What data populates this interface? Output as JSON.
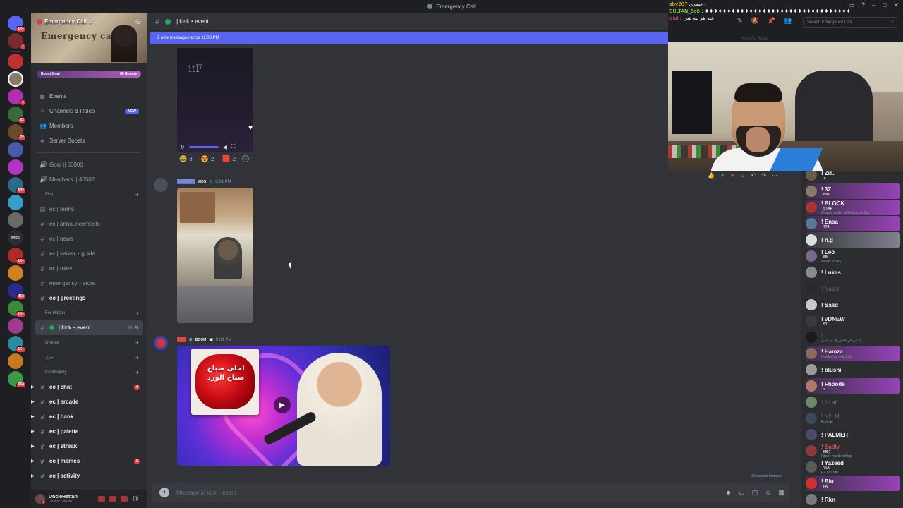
{
  "window": {
    "title": "Emergency Call"
  },
  "server": {
    "name": "Emergency Call",
    "banner_text": "Emergency call",
    "boost_goal_label": "Boost Goal",
    "boost_count": "66 Boosts"
  },
  "rail": {
    "badges": [
      "1K+",
      "1",
      "1",
      "22",
      "22",
      "502",
      "1K+",
      "416",
      "1K+",
      "1K+",
      "654"
    ],
    "text_server": "Mts"
  },
  "menu": [
    {
      "icon": "calendar-icon",
      "label": "Events"
    },
    {
      "icon": "channels-icon",
      "label": "Channels & Roles",
      "badge": "NEW"
    },
    {
      "icon": "members-icon",
      "label": "Members"
    },
    {
      "icon": "boost-icon",
      "label": "Server Boosts"
    }
  ],
  "stats": [
    {
      "label": "Goal || 50000"
    },
    {
      "label": "Members || 45502"
    }
  ],
  "categories": {
    "first": "First",
    "for_hattan": "For Hattan",
    "groups": "Groups",
    "arabic": "أخرى",
    "community": "Community"
  },
  "channels_first": [
    "ec | terms",
    "ec | announcements",
    "ec | news",
    "ec | server・guide",
    "ec | roles",
    "emergency・store"
  ],
  "channel_greetings": "ec | greetings",
  "channel_selected": "| kick・event",
  "channels_community": [
    {
      "label": "ec | chat",
      "badge": "4"
    },
    {
      "label": "ec | arcade"
    },
    {
      "label": "ec | bank"
    },
    {
      "label": "ec | palette"
    },
    {
      "label": "ec | streak"
    },
    {
      "label": "ec | memes",
      "badge": "1"
    },
    {
      "label": "ec | activity"
    }
  ],
  "user": {
    "name": "UncleHattan",
    "status": "Do Not Disturb"
  },
  "chat": {
    "header": "| kick・event",
    "new_messages": "2 new messages since 11:03 PM",
    "video_mark": "itF",
    "reactions": [
      {
        "emoji": "😂",
        "count": "3"
      },
      {
        "emoji": "😍",
        "count": "2"
      },
      {
        "emoji": "🟥",
        "count": "2"
      }
    ],
    "msg1": {
      "tag": "WDS",
      "time": "8:01 PM"
    },
    "msg2": {
      "tag": "BOOM",
      "time": "8:01 PM"
    },
    "card_text": "احلى صباح صباح الورد",
    "slowmode": "Slowmode Immune",
    "composer_placeholder": "Message #| kick・event"
  },
  "overlay": {
    "chat_lines": [
      {
        "name": "sbv207",
        "text": "خصري :"
      },
      {
        "name": "SULTAN_5o6",
        "text": ": ♦♦♦♦♦♦♦♦♦♦♦♦♦♦♦♦♦♦♦♦♦♦♦♦♦♦♦♦♦♦♦♦♦"
      },
      {
        "name": "aiul",
        "text": ": عيه هو ليه شي"
      }
    ],
    "search_placeholder": "Search Emergency Call",
    "mark_as_read": "Mark As Read"
  },
  "members": [
    {
      "name": "! Zia.",
      "sub": "",
      "tag": "✦",
      "style": "normal"
    },
    {
      "name": "! 3Z",
      "sub": "",
      "tag": "NxT",
      "style": "fancy"
    },
    {
      "name": "! BLOCK",
      "sub": "Always smile, still happy in the",
      "tag": "STAR",
      "style": "fancy"
    },
    {
      "name": "! Ensa",
      "sub": "",
      "tag": "774",
      "style": "fancy"
    },
    {
      "name": "! h.g",
      "sub": "",
      "tag": "",
      "style": "fancy2"
    },
    {
      "name": "! Leo",
      "sub": "ARAB PURE",
      "tag": "MK",
      "style": "normal"
    },
    {
      "name": "! Lukas",
      "sub": "",
      "tag": "",
      "style": "normal"
    },
    {
      "name": "! Nasol",
      "sub": "",
      "tag": "",
      "style": "dim"
    },
    {
      "name": "! Saad",
      "sub": "",
      "tag": "",
      "style": "normal"
    },
    {
      "name": "! vDNEW",
      "sub": "",
      "tag": "511",
      "style": "normal"
    },
    {
      "name": "! ...",
      "sub": "لا تمن في القول إلا هو الحق",
      "tag": "",
      "style": "dim"
    },
    {
      "name": "! Hamza",
      "sub": "I make my own luck",
      "tag": "",
      "style": "fancy"
    },
    {
      "name": "! blushi",
      "sub": "",
      "tag": "",
      "style": "normal"
    },
    {
      "name": "! Fhoode",
      "sub": "",
      "tag": "♥",
      "style": "fancy"
    },
    {
      "name": "! im ali",
      "sub": "",
      "tag": "",
      "style": "dim"
    },
    {
      "name": "! N2LM",
      "sub": "Fortnite",
      "tag": "",
      "style": "dim"
    },
    {
      "name": "! PALMER",
      "sub": "",
      "tag": "",
      "style": "normal"
    },
    {
      "name": "! Sadly",
      "sub": "I don't need nothing",
      "tag": "MB7",
      "style": "red"
    },
    {
      "name": "! Yazeed",
      "sub": "EZ On Top",
      "tag": "YLN",
      "style": "normal"
    },
    {
      "name": "! Blu",
      "sub": "",
      "tag": "FN",
      "style": "fancy"
    },
    {
      "name": "! Rkn",
      "sub": "",
      "tag": "",
      "style": "normal"
    }
  ],
  "colors": {
    "accent": "#5865f2",
    "online": "#23a55a",
    "mention": "#f23f43",
    "sidebar": "#2b2d31",
    "chat_bg": "#313338"
  }
}
